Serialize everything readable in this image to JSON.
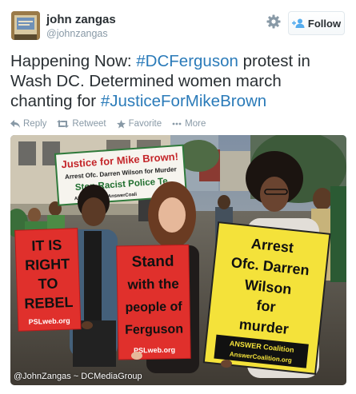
{
  "user": {
    "name": "john zangas",
    "handle": "@johnzangas"
  },
  "follow_button": {
    "label": "Follow",
    "icon": "add-user-icon"
  },
  "settings_icon": "gear-icon",
  "tweet": {
    "text_1": "Happening Now: ",
    "hashtag_1": "#DCFerguson",
    "text_2": " protest in Wash DC. Determined women march chanting for ",
    "hashtag_2": "#JusticeForMikeBrown"
  },
  "actions": [
    {
      "label": "Reply",
      "icon": "reply-icon"
    },
    {
      "label": "Retweet",
      "icon": "retweet-icon"
    },
    {
      "label": "Favorite",
      "icon": "star-icon"
    },
    {
      "label": "More",
      "icon": "more-icon"
    }
  ],
  "photo": {
    "watermark": "@JohnZangas ~ DCMediaGroup",
    "sign_back": {
      "line1": "Justice for Mike Brown!",
      "line2": "Arrest Ofc. Darren Wilson for Murder",
      "line3": "Stop Racist Police Te",
      "line4": "ANSWER",
      "line5": "AnswerCoali"
    },
    "sign_left": {
      "line1": "IT IS",
      "line2": "RIGHT",
      "line3": "TO",
      "line4": "REBEL",
      "footer": "PSLweb.org"
    },
    "sign_middle": {
      "line1": "Stand",
      "line2": "with the",
      "line3": "people of",
      "line4": "Ferguson",
      "footer": "PSLweb.org"
    },
    "sign_right": {
      "line1": "Arrest",
      "line2": "Ofc. Darren",
      "line3": "Wilson",
      "line4": "for",
      "line5": "murder",
      "footer1": "ANSWER Coalition",
      "footer2": "AnswerCoalition.org"
    }
  },
  "colors": {
    "hashtag": "#2b7bb9",
    "muted": "#8899a6",
    "text": "#292f33",
    "sign_red": "#e0302c",
    "sign_yellow": "#f4e23a"
  }
}
